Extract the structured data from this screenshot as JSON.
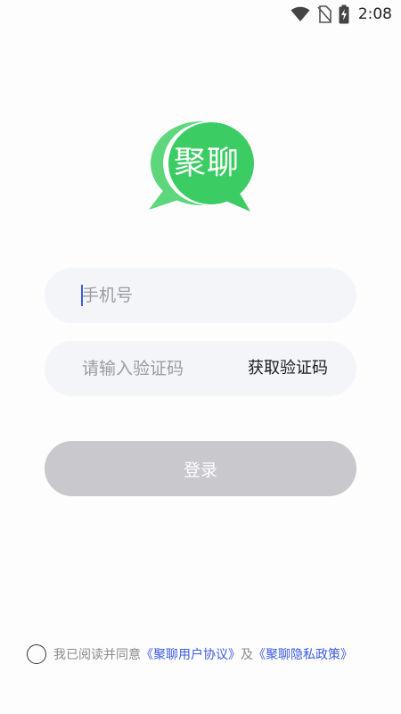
{
  "status_bar": {
    "time": "2:08",
    "icons": [
      "wifi-icon",
      "no-sim-icon",
      "battery-charging-icon"
    ]
  },
  "logo": {
    "text": "聚聊",
    "colors": {
      "bubble_front": "#3ccc64",
      "bubble_back": "#5ed67c",
      "text": "#ffffff"
    }
  },
  "login_form": {
    "phone_placeholder": "手机号",
    "phone_value": "",
    "code_placeholder": "请输入验证码",
    "code_value": "",
    "get_code_label": "获取验证码",
    "login_label": "登录"
  },
  "agreement": {
    "prefix": "我已阅读并同意",
    "user_agreement_link": "《聚聊用户协议》",
    "conjunction": "及",
    "privacy_policy_link": "《聚聊隐私政策》",
    "checked": false
  },
  "colors": {
    "background": "#fdfdfe",
    "input_background": "#f4f5f9",
    "button_disabled": "#c8c8cd",
    "link": "#3b5ce0",
    "caret": "#3b5bdb"
  }
}
